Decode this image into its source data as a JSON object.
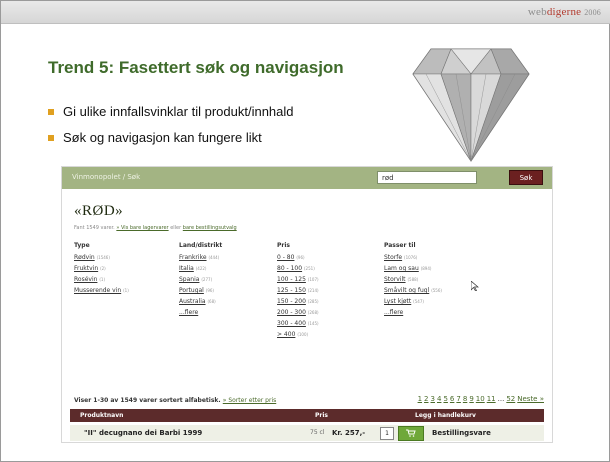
{
  "brand": {
    "part1": "web",
    "part2": "digerne",
    "year": "2006"
  },
  "slide": {
    "title": "Trend 5: Fasettert søk og navigasjon",
    "bullets": [
      "Gi ulike innfallsvinklar til produkt/innhald",
      "Søk og navigasjon kan fungere likt"
    ]
  },
  "site": {
    "breadcrumb": "Vinmonopolet / Søk",
    "search_value": "rød",
    "search_button": "Søk",
    "heading": "«RØD»",
    "found_text": "Fant 1549 varer.",
    "found_link": "» Vis bare lagervarer",
    "found_or": "eller",
    "found_link2": "bare bestillingsutvalg",
    "facets": [
      {
        "title": "Type",
        "items": [
          {
            "label": "Rødvin",
            "count": "(1546)"
          },
          {
            "label": "Fruktvin",
            "count": "(2)"
          },
          {
            "label": "Rosévin",
            "count": "(1)"
          },
          {
            "label": "Musserende vin",
            "count": "(1)"
          }
        ]
      },
      {
        "title": "Land/distrikt",
        "items": [
          {
            "label": "Frankrike",
            "count": "(444)"
          },
          {
            "label": "Italia",
            "count": "(422)"
          },
          {
            "label": "Spania",
            "count": "(277)"
          },
          {
            "label": "Portugal",
            "count": "(96)"
          },
          {
            "label": "Australia",
            "count": "(68)"
          },
          {
            "label": "...flere",
            "count": ""
          }
        ]
      },
      {
        "title": "Pris",
        "items": [
          {
            "label": "0 - 80",
            "count": "(96)"
          },
          {
            "label": "80 - 100",
            "count": "(251)"
          },
          {
            "label": "100 - 125",
            "count": "(107)"
          },
          {
            "label": "125 - 150",
            "count": "(214)"
          },
          {
            "label": "150 - 200",
            "count": "(285)"
          },
          {
            "label": "200 - 300",
            "count": "(268)"
          },
          {
            "label": "300 - 400",
            "count": "(145)"
          },
          {
            "label": "> 400",
            "count": "(100)"
          }
        ]
      },
      {
        "title": "Passer til",
        "items": [
          {
            "label": "Storfe",
            "count": "(1076)"
          },
          {
            "label": "Lam og sau",
            "count": "(894)"
          },
          {
            "label": "Storvilt",
            "count": "(588)"
          },
          {
            "label": "Småvilt og fugl",
            "count": "(556)"
          },
          {
            "label": "Lyst kjøtt",
            "count": "(547)"
          },
          {
            "label": "...flere",
            "count": ""
          }
        ]
      }
    ],
    "results_text": "Viser 1-30 av 1549 varer sortert alfabetisk.",
    "sort_link": "» Sorter etter pris",
    "pages": [
      "1",
      "2",
      "3",
      "4",
      "5",
      "6",
      "7",
      "8",
      "9",
      "10",
      "11",
      "...",
      "52",
      "Neste »"
    ],
    "table_headers": {
      "name": "Produktnavn",
      "price": "Pris",
      "cart": "Legg i handlekurv"
    },
    "row": {
      "name": "\"II\" decugnano dei Barbi 1999",
      "volume": "75 cl",
      "price": "Kr. 257,-",
      "qty": "1",
      "status": "Bestillingsvare"
    }
  }
}
